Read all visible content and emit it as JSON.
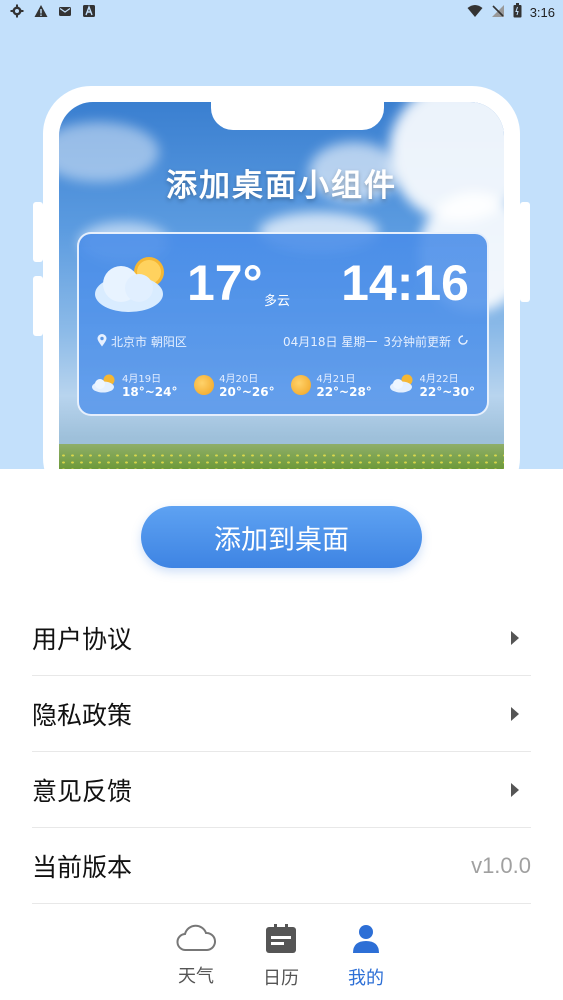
{
  "status_bar": {
    "time": "3:16",
    "left_icons": [
      "settings-icon",
      "warning-icon",
      "mail-icon",
      "a-icon"
    ],
    "right_icons": [
      "wifi-icon",
      "no-signal-icon",
      "battery-icon"
    ]
  },
  "hero": {
    "title": "添加桌面小组件",
    "widget": {
      "temperature": "17°",
      "condition": "多云",
      "time": "14:16",
      "location": "北京市 朝阳区",
      "date": "04月18日 星期一",
      "updated": "3分钟前更新",
      "forecast": [
        {
          "date": "4月19日",
          "range": "18°~24°",
          "icon": "partly-cloudy-icon"
        },
        {
          "date": "4月20日",
          "range": "20°~26°",
          "icon": "sun-icon"
        },
        {
          "date": "4月21日",
          "range": "22°~28°",
          "icon": "sun-icon"
        },
        {
          "date": "4月22日",
          "range": "22°~30°",
          "icon": "partly-cloudy-icon"
        }
      ]
    }
  },
  "action": {
    "add_to_desktop": "添加到桌面"
  },
  "menu": {
    "items": [
      {
        "label": "用户协议"
      },
      {
        "label": "隐私政策"
      },
      {
        "label": "意见反馈"
      },
      {
        "label": "当前版本",
        "value": "v1.0.0"
      }
    ]
  },
  "tabs": [
    {
      "label": "天气",
      "icon": "cloud-icon"
    },
    {
      "label": "日历",
      "icon": "calendar-icon"
    },
    {
      "label": "我的",
      "icon": "person-icon",
      "active": true
    }
  ],
  "colors": {
    "accent": "#2d6fd6",
    "hero_background": "#c3e0fb",
    "button": "#4a8fe8"
  }
}
